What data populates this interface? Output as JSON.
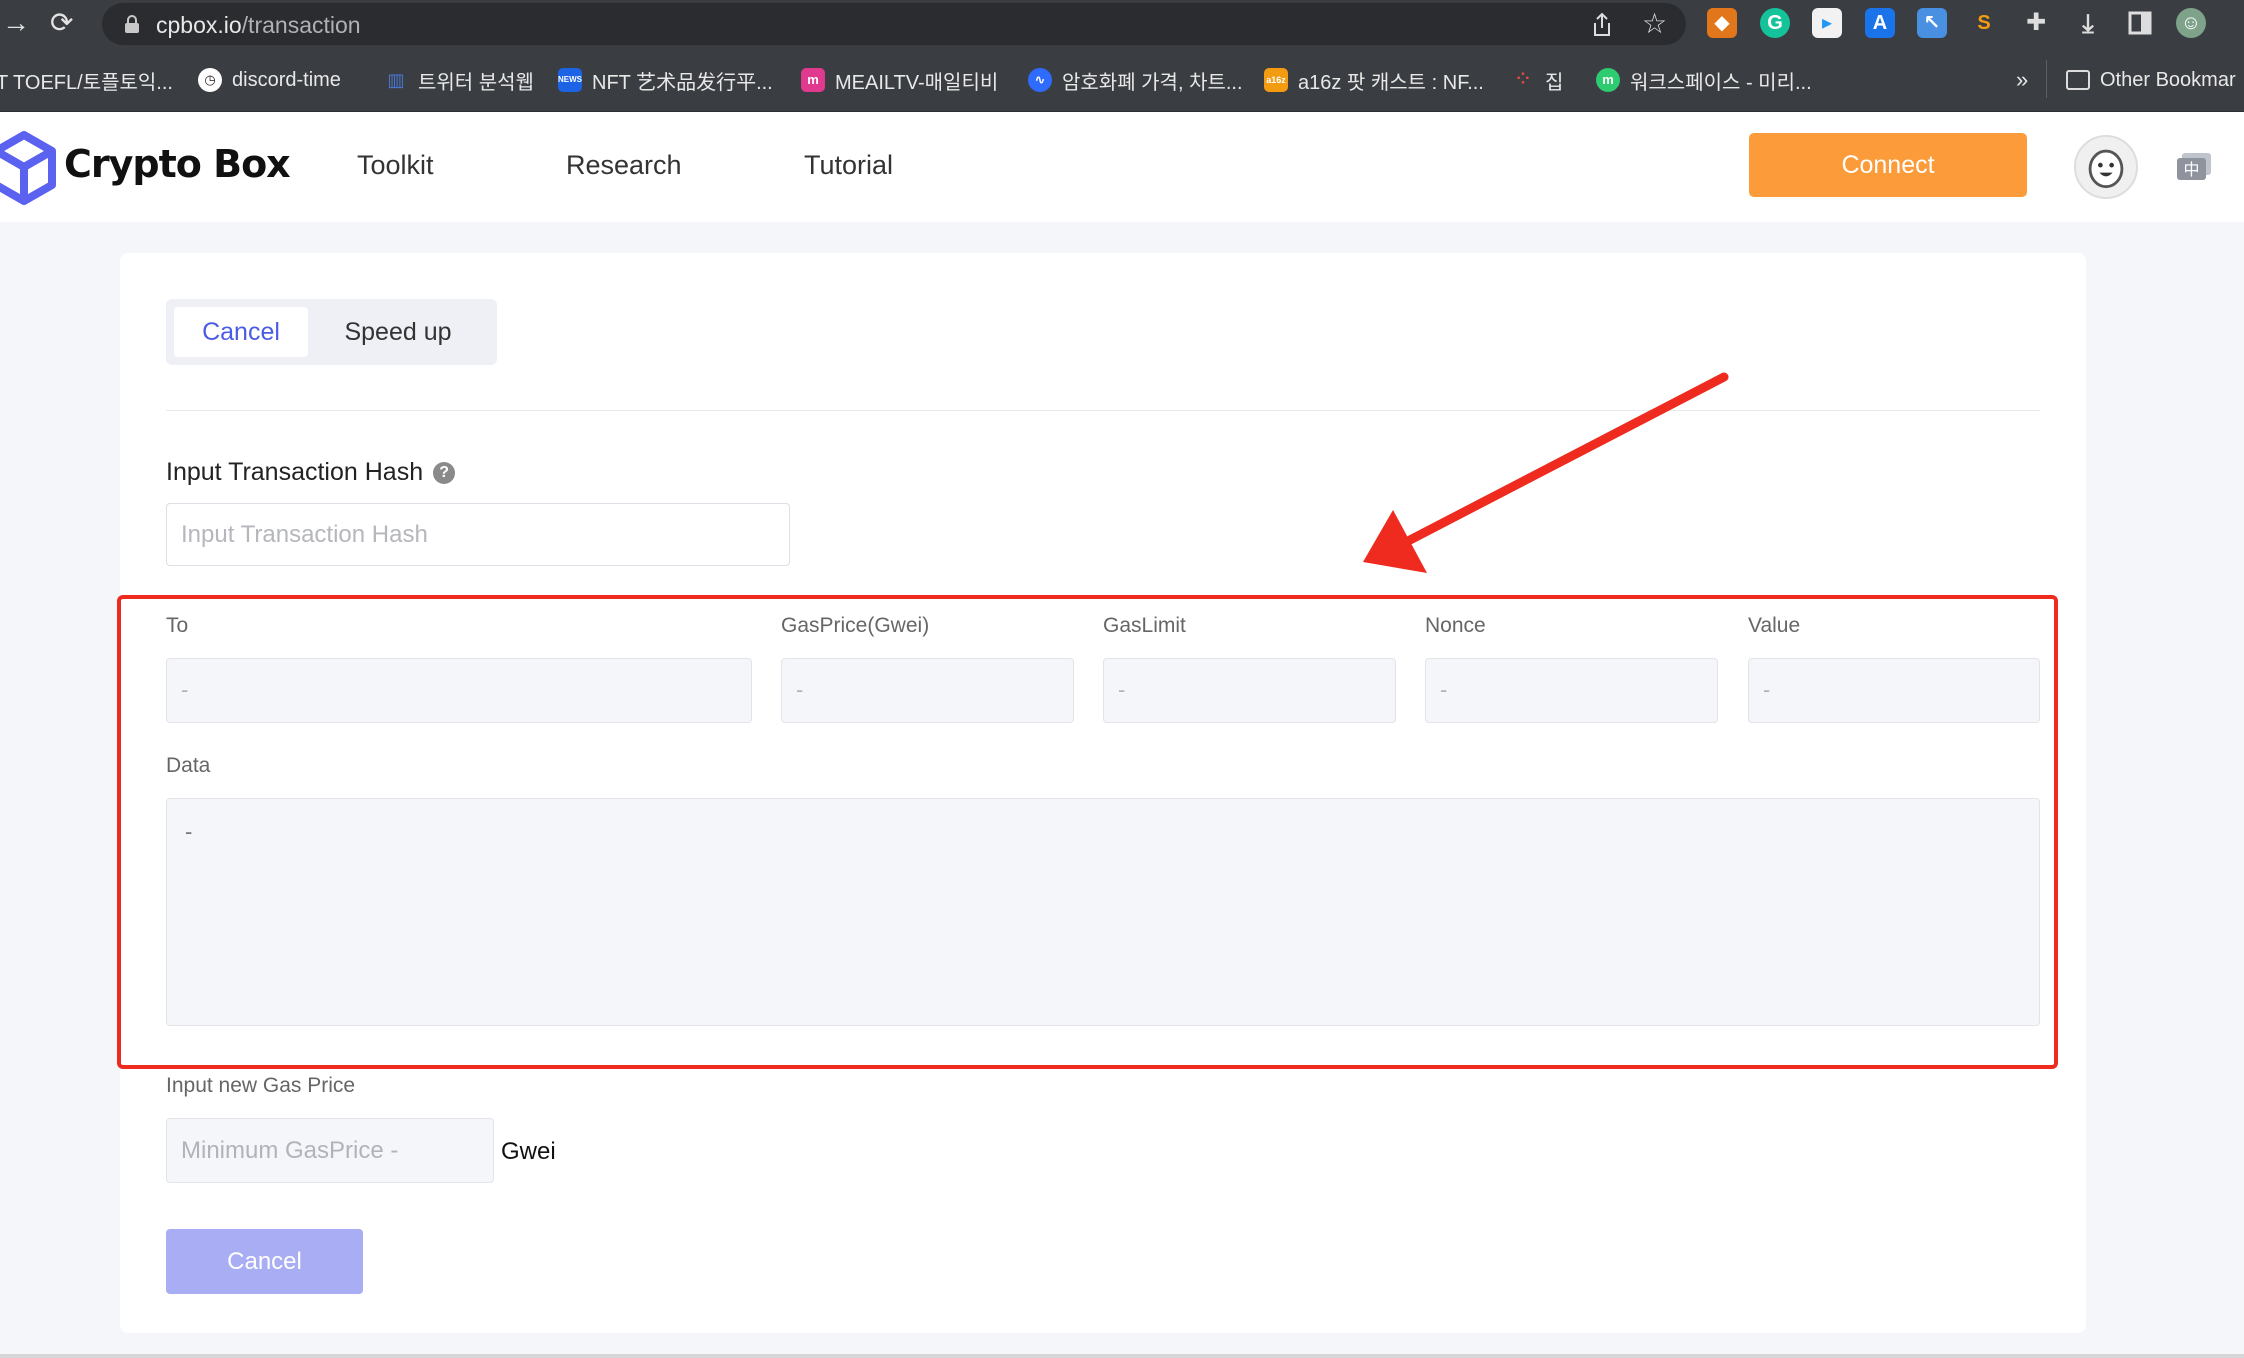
{
  "browser": {
    "url_host": "cpbox.io",
    "url_path": "/transaction",
    "bookmarks": [
      {
        "label": "T TOEFL/토플토익...",
        "icon_color": "#3a3d41"
      },
      {
        "label": "discord-time",
        "icon_color": "#ffffff"
      },
      {
        "label": "트위터 분석웹",
        "icon_color": "#4a78d9"
      },
      {
        "label": "NFT 艺术品发行平...",
        "icon_color": "#1c63e6"
      },
      {
        "label": "MEAILTV-매일티비",
        "icon_color": "#e0398d"
      },
      {
        "label": "암호화폐 가격, 차트...",
        "icon_color": "#2f6bff"
      },
      {
        "label": "a16z 팟 캐스트 : NF...",
        "icon_color": "#f39c12"
      },
      {
        "label": "집",
        "icon_color": "#e74c3c"
      },
      {
        "label": "워크스페이스 - 미리...",
        "icon_color": "#2ecc71"
      }
    ],
    "bookmarks_overflow": "»",
    "other_bookmarks": "Other Bookmar"
  },
  "header": {
    "brand": "Crypto Box",
    "nav": [
      "Toolkit",
      "Research",
      "Tutorial"
    ],
    "connect_label": "Connect",
    "lang_icon_text": "中"
  },
  "form": {
    "tabs": {
      "active": "Cancel",
      "other": "Speed up"
    },
    "hash_label": "Input Transaction Hash",
    "hash_placeholder": "Input Transaction Hash",
    "fields": [
      {
        "label": "To",
        "value": "-"
      },
      {
        "label": "GasPrice(Gwei)",
        "value": "-"
      },
      {
        "label": "GasLimit",
        "value": "-"
      },
      {
        "label": "Nonce",
        "value": "-"
      },
      {
        "label": "Value",
        "value": "-"
      }
    ],
    "data_label": "Data",
    "data_value": "-",
    "gas_label": "Input new Gas Price",
    "gas_placeholder": "Minimum GasPrice -",
    "gas_unit": "Gwei",
    "submit_label": "Cancel"
  },
  "colors": {
    "accent": "#4b5ce4",
    "connect": "#fb9b3a",
    "submit_disabled": "#a8adf4",
    "annotation": "#ef2a1e"
  }
}
